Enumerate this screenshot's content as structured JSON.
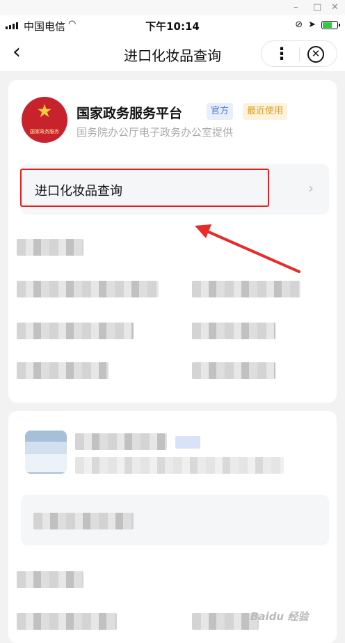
{
  "status_bar": {
    "carrier": "中国电信",
    "time": "下午10:14"
  },
  "nav": {
    "back_icon": "chevron-left-icon",
    "title": "进口化妆品查询",
    "more_icon": "more-dots-icon",
    "close_icon": "close-circle-icon"
  },
  "service_card": {
    "emblem_text": "国家政务服务",
    "org_name": "国家政务服务平台",
    "badge_official": "官方",
    "badge_recent": "最近使用",
    "subtitle": "国务院办公厅电子政务办公室提供",
    "entry_label": "进口化妆品查询"
  },
  "annotation": {
    "highlight_color": "#e02020",
    "arrow_color": "#e82a2a"
  },
  "watermark": {
    "text": "Baidu 经验"
  },
  "colors": {
    "badge_official_text": "#4a7bd9",
    "badge_recent_text": "#d69b21",
    "emblem": "#c8232c"
  }
}
